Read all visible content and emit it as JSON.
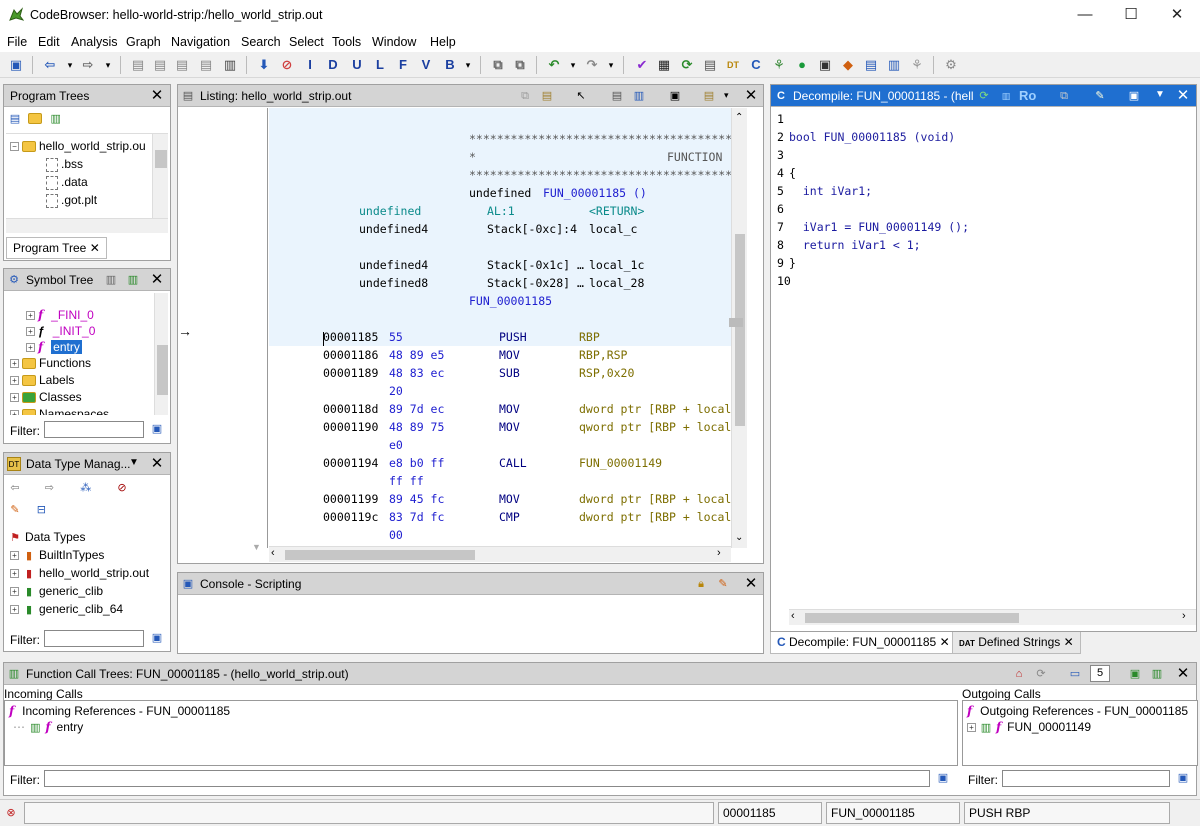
{
  "window": {
    "title": "CodeBrowser: hello-world-strip:/hello_world_strip.out",
    "minimize": "—",
    "maximize": "☐",
    "close": "✕"
  },
  "menu": [
    "File",
    "Edit",
    "Analysis",
    "Graph",
    "Navigation",
    "Search",
    "Select",
    "Tools",
    "Window",
    "Help"
  ],
  "toolbar_letters": [
    "I",
    "D",
    "U",
    "L",
    "F",
    "V",
    "B"
  ],
  "program_trees": {
    "title": "Program Trees",
    "root": "hello_world_strip.ou",
    "items": [
      ".bss",
      ".data",
      ".got.plt"
    ],
    "tab": "Program Tree"
  },
  "symbol_tree": {
    "title": "Symbol Tree",
    "items": [
      "_FINI_0",
      "_INIT_0",
      "entry"
    ],
    "folders": [
      "Functions",
      "Labels",
      "Classes",
      "Namespaces"
    ],
    "filter_label": "Filter:"
  },
  "data_type_manager": {
    "title": "Data Type Manag...",
    "root": "Data Types",
    "items": [
      "BuiltInTypes",
      "hello_world_strip.out",
      "generic_clib",
      "generic_clib_64"
    ],
    "filter_label": "Filter:"
  },
  "listing": {
    "title": "Listing:  hello_world_strip.out",
    "stars": "***************************************",
    "function_hdr": "FUNCTION",
    "star_char": "*",
    "signature_type": "undefined",
    "signature_name": "FUN_00001185 ()",
    "vars": [
      {
        "type": "undefined",
        "loc": "AL:1",
        "name": "<RETURN>"
      },
      {
        "type": "undefined4",
        "loc": "Stack[-0xc]:4",
        "name": "local_c"
      },
      {
        "type": "undefined4",
        "loc": "Stack[-0x1c] …",
        "name": "local_1c"
      },
      {
        "type": "undefined8",
        "loc": "Stack[-0x28] …",
        "name": "local_28"
      }
    ],
    "label": "FUN_00001185",
    "instructions": [
      {
        "addr": "00001185",
        "bytes": "55",
        "mnem": "PUSH",
        "ops": "RBP"
      },
      {
        "addr": "00001186",
        "bytes": "48 89 e5",
        "mnem": "MOV",
        "ops": "RBP,RSP"
      },
      {
        "addr": "00001189",
        "bytes": "48 83 ec",
        "mnem": "SUB",
        "ops": "RSP,0x20"
      },
      {
        "addr": "",
        "bytes": "20",
        "mnem": "",
        "ops": ""
      },
      {
        "addr": "0000118d",
        "bytes": "89 7d ec",
        "mnem": "MOV",
        "ops": "dword ptr [RBP + local"
      },
      {
        "addr": "00001190",
        "bytes": "48 89 75",
        "mnem": "MOV",
        "ops": "qword ptr [RBP + local"
      },
      {
        "addr": "",
        "bytes": "e0",
        "mnem": "",
        "ops": ""
      },
      {
        "addr": "00001194",
        "bytes": "e8 b0 ff",
        "mnem": "CALL",
        "ops": "FUN_00001149"
      },
      {
        "addr": "",
        "bytes": "ff ff",
        "mnem": "",
        "ops": ""
      },
      {
        "addr": "00001199",
        "bytes": "89 45 fc",
        "mnem": "MOV",
        "ops": "dword ptr [RBP + local"
      },
      {
        "addr": "0000119c",
        "bytes": "83 7d fc",
        "mnem": "CMP",
        "ops": "dword ptr [RBP + local"
      },
      {
        "addr": "",
        "bytes": "00",
        "mnem": "",
        "ops": ""
      }
    ]
  },
  "decompile": {
    "title": "Decompile: FUN_00001185 -  (hell",
    "ro": "Ro",
    "lines": [
      "",
      "bool FUN_00001185 (void)",
      "",
      "{",
      "  int iVar1;",
      "",
      "  iVar1 = FUN_00001149 ();",
      "  return iVar1 < 1;",
      "}",
      ""
    ],
    "tabs": [
      "Decompile: FUN_00001185",
      "Defined Strings"
    ]
  },
  "console": {
    "title": "Console - Scripting"
  },
  "call_trees": {
    "title": "Function Call Trees: FUN_00001185 -  (hello_world_strip.out)",
    "count": "5",
    "incoming_label": "Incoming Calls",
    "incoming_root": "Incoming References - FUN_00001185",
    "incoming_items": [
      "entry"
    ],
    "outgoing_label": "Outgoing Calls",
    "outgoing_root": "Outgoing References - FUN_00001185",
    "outgoing_items": [
      "FUN_00001149"
    ],
    "filter_label": "Filter:"
  },
  "status": {
    "address": "00001185",
    "function": "FUN_00001185",
    "instruction": "PUSH RBP"
  },
  "colors": {
    "accent": "#1f6fd0",
    "function_purple": "#c000c0"
  }
}
